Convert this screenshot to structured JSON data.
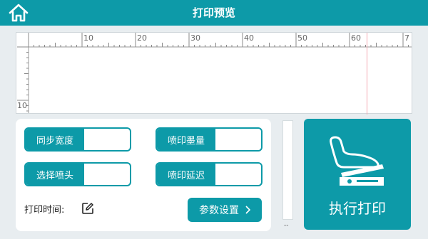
{
  "header": {
    "title": "打印预览",
    "home_icon": "home-icon"
  },
  "preview": {
    "ruler_top_labels": [
      "10",
      "20",
      "30",
      "40",
      "50",
      "60",
      "7"
    ],
    "ruler_left_labels": [
      "10"
    ],
    "marker_color": "#f4a7b0"
  },
  "settings": {
    "sync_width_label": "同步宽度",
    "sync_width_value": "",
    "ink_amount_label": "喷印墨量",
    "ink_amount_value": "",
    "select_head_label": "选择喷头",
    "select_head_value": "",
    "print_delay_label": "喷印延迟",
    "print_delay_value": "",
    "print_time_label": "打印时间:",
    "edit_icon": "edit-icon",
    "param_button_label": "参数设置",
    "param_button_icon": "chevron-right-icon"
  },
  "side": {
    "dash": "--"
  },
  "execute": {
    "label": "执行打印",
    "icon": "foot-pedal-icon"
  },
  "colors": {
    "accent": "#0d9aa8",
    "background": "#e8edf0"
  }
}
